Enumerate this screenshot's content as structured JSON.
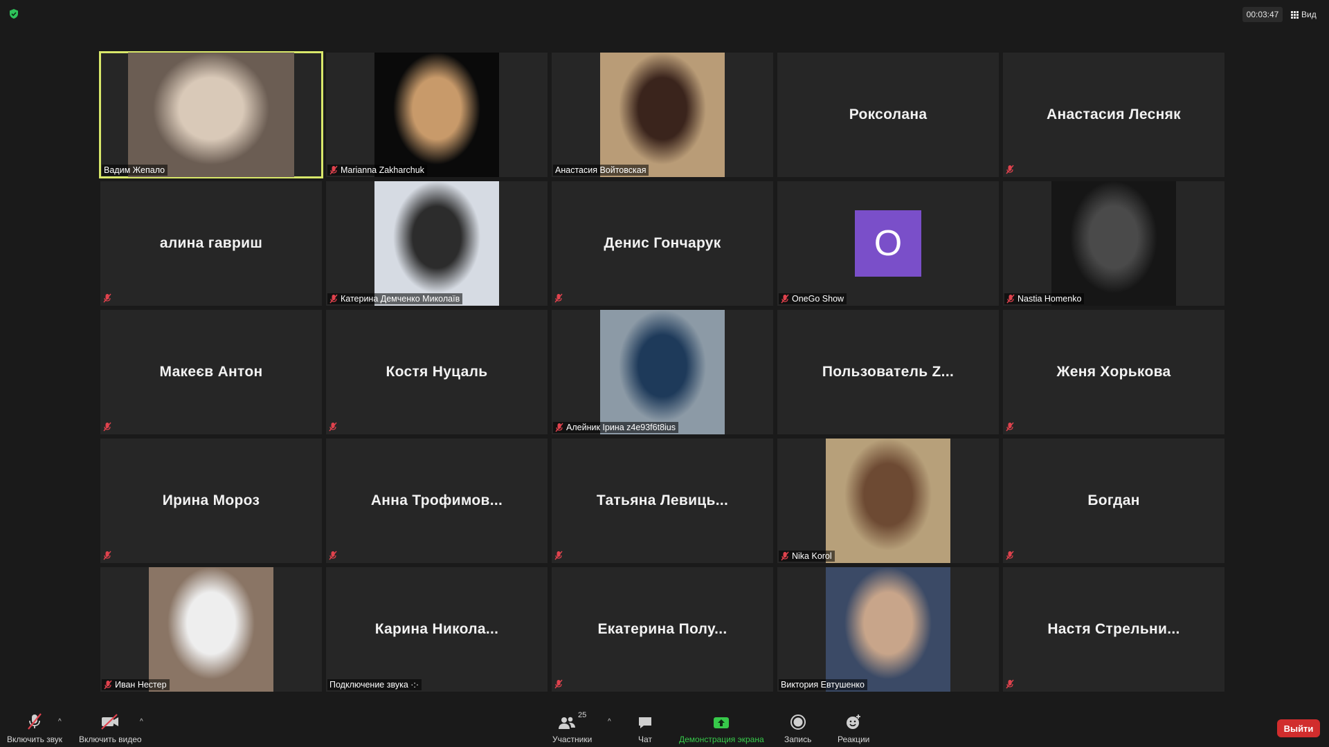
{
  "topbar": {
    "timer": "00:03:47",
    "view_label": "Вид"
  },
  "tiles": [
    {
      "name": "Вадим Жепало",
      "mode": "video",
      "active": true,
      "muted": false,
      "label": "Вадим Жепало",
      "bg": "#6b5d53",
      "fg": "#d9c9b8"
    },
    {
      "name": "Marianna Zakharchuk",
      "mode": "video",
      "muted": true,
      "label": "Marianna Zakharchuk",
      "bg": "#0a0a0a",
      "fg": "#c89a6a"
    },
    {
      "name": "Анастасия Войтовская",
      "mode": "video",
      "muted": false,
      "label": "Анастасия Войтовская",
      "bg": "#b99c77",
      "fg": "#3a241c"
    },
    {
      "name": "Роксолана",
      "mode": "name",
      "muted": false
    },
    {
      "name": "Анастасия Лесняк",
      "mode": "name",
      "muted": true
    },
    {
      "name": "алина гавриш",
      "mode": "name",
      "muted": true
    },
    {
      "name": "Катерина Демченко Миколаїв",
      "mode": "video",
      "muted": true,
      "label": "Катерина Демченко Миколаїв",
      "bg": "#d6dbe3",
      "fg": "#2c2c2c"
    },
    {
      "name": "Денис Гончарук",
      "mode": "name",
      "muted": true
    },
    {
      "name": "OneGo Show",
      "mode": "avatar",
      "avatar_letter": "O",
      "muted": true,
      "label": "OneGo Show"
    },
    {
      "name": "Nastia Homenko",
      "mode": "video",
      "muted": true,
      "label": "Nastia Homenko",
      "bg": "#161616",
      "fg": "#4a4a4a"
    },
    {
      "name": "Макеєв Антон",
      "mode": "name",
      "muted": true
    },
    {
      "name": "Костя Нуцаль",
      "mode": "name",
      "muted": true
    },
    {
      "name": "Алейник Ірина z4e93f6t8ius",
      "mode": "video",
      "muted": true,
      "label": "Алейник Ірина z4e93f6t8ius",
      "bg": "#8c9aa6",
      "fg": "#1e3a5a"
    },
    {
      "name": "Пользователь  Z...",
      "mode": "name",
      "muted": false
    },
    {
      "name": "Женя Хорькова",
      "mode": "name",
      "muted": true
    },
    {
      "name": "Ирина Мороз",
      "mode": "name",
      "muted": true
    },
    {
      "name": "Анна  Трофимов...",
      "mode": "name",
      "muted": true
    },
    {
      "name": "Татьяна  Левиць...",
      "mode": "name",
      "muted": true
    },
    {
      "name": "Nika Korol",
      "mode": "video",
      "muted": true,
      "label": "Nika Korol",
      "bg": "#b7a07a",
      "fg": "#6d4a33"
    },
    {
      "name": "Богдан",
      "mode": "name",
      "muted": true
    },
    {
      "name": "Иван Нестер",
      "mode": "video",
      "muted": true,
      "label": "Иван Нестер",
      "bg": "#8a7565",
      "fg": "#eeeeee"
    },
    {
      "name": "Карина  Никола...",
      "mode": "name",
      "muted": false,
      "status_label": "Подключение звука ·:·"
    },
    {
      "name": "Екатерина  Полу...",
      "mode": "name",
      "muted": true
    },
    {
      "name": "Виктория Евтушенко",
      "mode": "video",
      "muted": false,
      "label": "Виктория Евтушенко",
      "bg": "#3b4a66",
      "fg": "#c8a58a"
    },
    {
      "name": "Настя  Стрельни...",
      "mode": "name",
      "muted": true
    }
  ],
  "toolbar": {
    "audio_label": "Включить звук",
    "video_label": "Включить видео",
    "participants_label": "Участники",
    "participants_count": "25",
    "chat_label": "Чат",
    "share_label": "Демонстрация экрана",
    "record_label": "Запись",
    "reactions_label": "Реакции",
    "leave_label": "Выйти"
  },
  "colors": {
    "active_border": "#d9e86a",
    "share_green": "#37c94a",
    "leave_red": "#d12d2d",
    "mute_red": "#e0424d"
  }
}
